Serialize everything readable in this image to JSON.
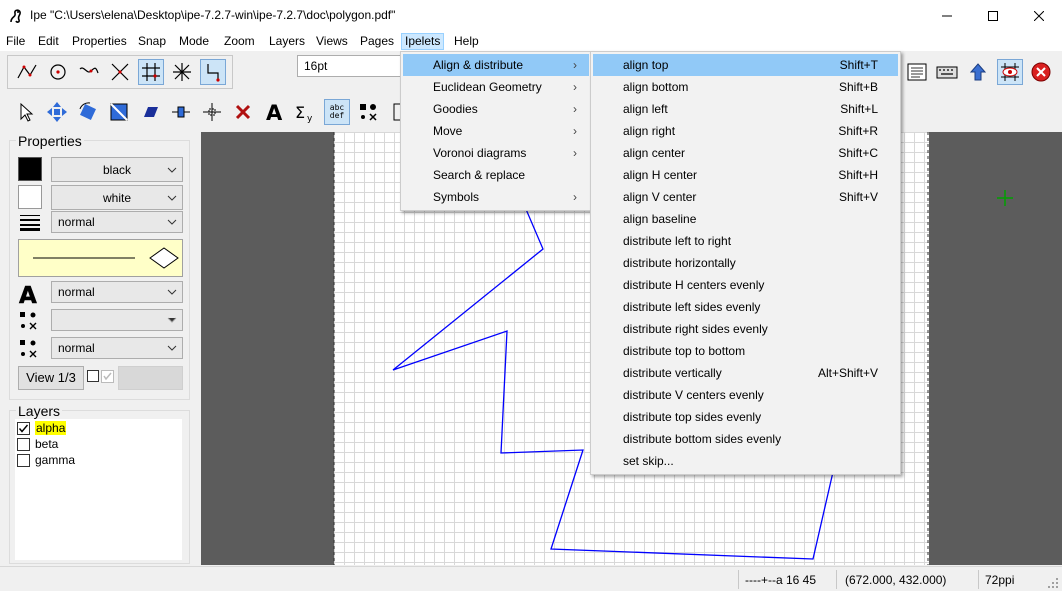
{
  "window": {
    "title": "Ipe \"C:\\Users\\elena\\Desktop\\ipe-7.2.7-win\\ipe-7.2.7\\doc\\polygon.pdf\"",
    "minimize_glyph": "—",
    "maximize_glyph": "☐",
    "close_glyph": "✕"
  },
  "menubar": {
    "items": [
      "File",
      "Edit",
      "Properties",
      "Snap",
      "Mode",
      "Zoom",
      "Layers",
      "Views",
      "Pages",
      "Ipelets",
      "Help"
    ],
    "active": "Ipelets"
  },
  "toolbar": {
    "grid_size": "16pt",
    "abc_label": "abc",
    "def_label": "def"
  },
  "properties": {
    "title": "Properties",
    "stroke_color": "black",
    "fill_color": "white",
    "pen": "normal",
    "text_size": "normal",
    "mark_shape": "",
    "symbol_size": "normal",
    "view_button": "View 1/3"
  },
  "layers": {
    "title": "Layers",
    "items": [
      {
        "name": "alpha",
        "checked": true,
        "highlight": true
      },
      {
        "name": "beta",
        "checked": false,
        "highlight": false
      },
      {
        "name": "gamma",
        "checked": false,
        "highlight": false
      }
    ]
  },
  "ipelets_menu": {
    "items": [
      {
        "label": "Align & distribute",
        "submenu": true
      },
      {
        "label": "Euclidean Geometry",
        "submenu": true
      },
      {
        "label": "Goodies",
        "submenu": true
      },
      {
        "label": "Move",
        "submenu": true
      },
      {
        "label": "Voronoi diagrams",
        "submenu": true
      },
      {
        "label": "Search & replace",
        "submenu": false
      },
      {
        "label": "Symbols",
        "submenu": true
      }
    ],
    "highlighted": 0
  },
  "align_submenu": {
    "items": [
      {
        "label": "align top",
        "shortcut": "Shift+T"
      },
      {
        "label": "align bottom",
        "shortcut": "Shift+B"
      },
      {
        "label": "align left",
        "shortcut": "Shift+L"
      },
      {
        "label": "align right",
        "shortcut": "Shift+R"
      },
      {
        "label": "align center",
        "shortcut": "Shift+C"
      },
      {
        "label": "align H center",
        "shortcut": "Shift+H"
      },
      {
        "label": "align V center",
        "shortcut": "Shift+V"
      },
      {
        "label": "align baseline",
        "shortcut": ""
      },
      {
        "label": "distribute left to right",
        "shortcut": ""
      },
      {
        "label": "distribute horizontally",
        "shortcut": ""
      },
      {
        "label": "distribute H centers evenly",
        "shortcut": ""
      },
      {
        "label": "distribute left sides evenly",
        "shortcut": ""
      },
      {
        "label": "distribute right sides evenly",
        "shortcut": ""
      },
      {
        "label": "distribute top to bottom",
        "shortcut": ""
      },
      {
        "label": "distribute vertically",
        "shortcut": "Alt+Shift+V"
      },
      {
        "label": "distribute V centers evenly",
        "shortcut": ""
      },
      {
        "label": "distribute top sides evenly",
        "shortcut": ""
      },
      {
        "label": "distribute bottom sides evenly",
        "shortcut": ""
      },
      {
        "label": "set skip...",
        "shortcut": ""
      }
    ],
    "highlighted": 0
  },
  "statusbar": {
    "snap_info": "----+--a 16 45",
    "coordinates": "(672.000, 432.000)",
    "resolution": "72ppi"
  },
  "colors": {
    "polygon_stroke": "#0000ff",
    "menu_highlight": "#91c9f7",
    "layer_highlight": "#ffff00",
    "canvas_bg": "#5c5c5c",
    "cursor_cross": "#00a000"
  }
}
